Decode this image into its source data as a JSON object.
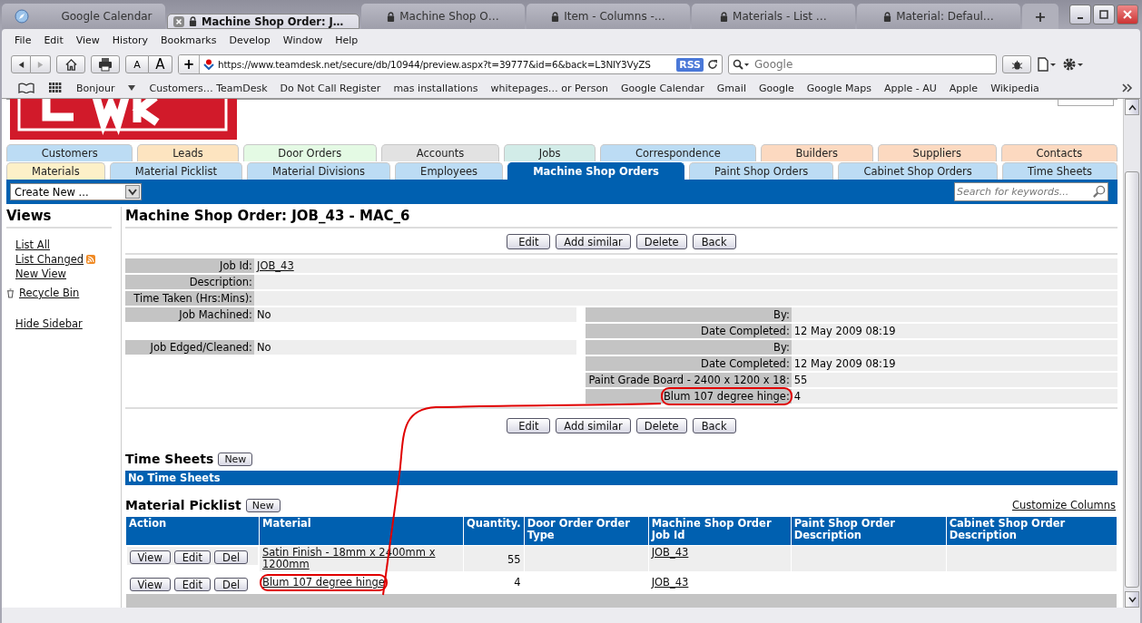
{
  "browser": {
    "tabs": [
      {
        "title": "Google Calendar",
        "secure": false,
        "selected": false
      },
      {
        "title": "Machine Shop Order: J…",
        "secure": true,
        "selected": true
      },
      {
        "title": "Machine Shop O…",
        "secure": true,
        "selected": false
      },
      {
        "title": "Item - Columns -…",
        "secure": true,
        "selected": false
      },
      {
        "title": "Materials - List …",
        "secure": true,
        "selected": false
      },
      {
        "title": "Material: Defaul…",
        "secure": true,
        "selected": false
      }
    ],
    "new_tab": "+",
    "menu": [
      "File",
      "Edit",
      "View",
      "History",
      "Bookmarks",
      "Develop",
      "Window",
      "Help"
    ],
    "text_smaller": "A",
    "text_bigger": "A",
    "add_button": "+",
    "url": "https://www.teamdesk.net/secure/db/10944/preview.aspx?t=39777&id=6&back=L3NlY3VyZS",
    "rss": "RSS",
    "search_placeholder": "Google",
    "bookmarks": [
      "Bonjour",
      "Customers… TeamDesk",
      "Do Not Call Register",
      "mas installations",
      "whitepages… or Person",
      "Google Calendar",
      "Gmail",
      "Google",
      "Google Maps",
      "Apple - AU",
      "Apple",
      "Wikipedia"
    ]
  },
  "nav_rows": [
    [
      {
        "label": "Customers",
        "color": "#bcdcf4",
        "selected": false
      },
      {
        "label": "Leads",
        "color": "#fde4c0",
        "selected": false
      },
      {
        "label": "Door Orders",
        "color": "#e4fae4",
        "selected": false
      },
      {
        "label": "Accounts",
        "color": "#e2e2e2",
        "selected": false
      },
      {
        "label": "Jobs",
        "color": "#d2ece8",
        "selected": false
      },
      {
        "label": "Correspondence",
        "color": "#bcdcf4",
        "selected": false
      },
      {
        "label": "Builders",
        "color": "#fcd9c0",
        "selected": false
      },
      {
        "label": "Suppliers",
        "color": "#fcd9c0",
        "selected": false
      },
      {
        "label": "Contacts",
        "color": "#fcd9c0",
        "selected": false
      }
    ],
    [
      {
        "label": "Materials",
        "color": "#fdf0c8",
        "selected": false
      },
      {
        "label": "Material Picklist",
        "color": "#bcdcf4",
        "selected": false
      },
      {
        "label": "Material Divisions",
        "color": "#bcdcf4",
        "selected": false
      },
      {
        "label": "Employees",
        "color": "#bcdcf4",
        "selected": false
      },
      {
        "label": "Machine Shop Orders",
        "color": "#0060b0",
        "selected": true
      },
      {
        "label": "Paint Shop Orders",
        "color": "#bcdcf4",
        "selected": false
      },
      {
        "label": "Cabinet Shop Orders",
        "color": "#bcdcf4",
        "selected": false
      },
      {
        "label": "Time Sheets",
        "color": "#bcdcf4",
        "selected": false
      }
    ]
  ],
  "create_new": "Create New ...",
  "search_placeholder": "Search for keywords...",
  "sidebar": {
    "title": "Views",
    "links": [
      {
        "label": "List All",
        "kind": "link"
      },
      {
        "label": "List Changed",
        "kind": "rss"
      },
      {
        "label": "New View",
        "kind": "link"
      },
      {
        "label": "Recycle Bin",
        "kind": "bin"
      },
      {
        "label": "Hide Sidebar",
        "kind": "link"
      }
    ]
  },
  "record": {
    "title": "Machine Shop Order: JOB_43 - MAC_6",
    "buttons": [
      "Edit",
      "Add similar",
      "Delete",
      "Back"
    ],
    "fields": [
      {
        "label": "Job Id:",
        "value": "JOB_43",
        "link": true
      },
      {
        "label": "Description:"
      },
      {
        "label": "Time Taken (Hrs:Mins):"
      }
    ],
    "left_fields": [
      {
        "kind": "field",
        "label": "Job Machined:",
        "value": "No"
      },
      {
        "kind": "gap"
      },
      {
        "kind": "field",
        "label": "Job Edged/Cleaned:",
        "value": "No"
      }
    ],
    "right_fields": [
      {
        "label": "By:",
        "circled": false
      },
      {
        "label": "Date Completed:",
        "value": "12 May 2009 08:19",
        "circled": false
      },
      {
        "label": "By:",
        "circled": false
      },
      {
        "label": "Date Completed:",
        "value": "12 May 2009 08:19",
        "circled": false
      },
      {
        "label": "Paint Grade Board - 2400 x 1200 x 18:",
        "value": "55",
        "circled": false
      },
      {
        "label": "Blum 107 degree hinge:",
        "value": "4",
        "circled": true
      }
    ],
    "bottom_buttons": [
      "Edit",
      "Add similar",
      "Delete",
      "Back"
    ]
  },
  "time_sheets": {
    "title": "Time Sheets",
    "new_button": "New",
    "empty": "No Time Sheets"
  },
  "picklist": {
    "title": "Material Picklist",
    "new_button": "New",
    "customize": "Customize Columns",
    "columns": [
      "Action",
      "Material",
      "Quantity.",
      "Door Order Order Type",
      "Machine Shop Order Job Id",
      "Paint Shop Order Description",
      "Cabinet Shop Order Description"
    ],
    "rows": [
      {
        "actions": [
          "View",
          "Edit",
          "Del"
        ],
        "material": "Satin Finish - 18mm x 2400mm x 1200mm",
        "quantity": "55",
        "job_id": "JOB_43",
        "circled": false
      },
      {
        "actions": [
          "View",
          "Edit",
          "Del"
        ],
        "material": "Blum 107 degree hinge",
        "quantity": "4",
        "job_id": "JOB_43",
        "circled": true
      }
    ]
  }
}
